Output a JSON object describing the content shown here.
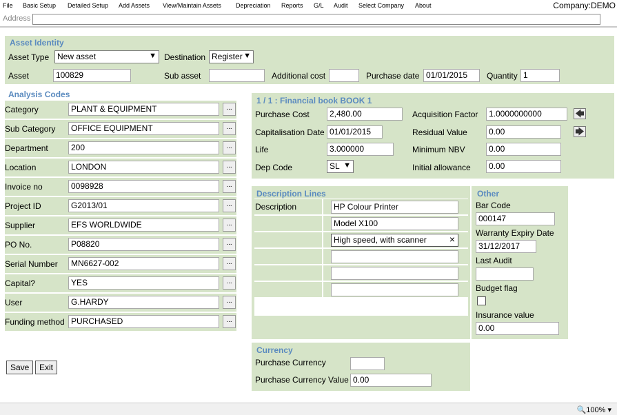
{
  "menu": {
    "items": [
      "File",
      "Basic Setup",
      "Detailed Setup",
      "Add Assets",
      "View/Maintain Assets",
      "Depreciation",
      "Reports",
      "G/L",
      "Audit",
      "Select Company",
      "About"
    ],
    "company": "Company:DEMO"
  },
  "address": {
    "label": "Address",
    "value": ""
  },
  "identity": {
    "title": "Asset Identity",
    "asset_type_label": "Asset Type",
    "asset_type_value": "New asset",
    "destination_label": "Destination",
    "destination_value": "Register",
    "asset_label": "Asset",
    "asset_value": "100829",
    "sub_asset_label": "Sub asset",
    "sub_asset_value": "",
    "additional_cost_label": "Additional cost",
    "additional_cost_value": "",
    "purchase_date_label": "Purchase date",
    "purchase_date_value": "01/01/2015",
    "quantity_label": "Quantity",
    "quantity_value": "1"
  },
  "analysis": {
    "title": "Analysis Codes",
    "rows": [
      {
        "label": "Category",
        "value": "PLANT & EQUIPMENT"
      },
      {
        "label": "Sub Category",
        "value": "OFFICE EQUIPMENT"
      },
      {
        "label": "Department",
        "value": "200"
      },
      {
        "label": "Location",
        "value": "LONDON"
      },
      {
        "label": "Invoice no",
        "value": "0098928"
      },
      {
        "label": "Project ID",
        "value": "G2013/01"
      },
      {
        "label": "Supplier",
        "value": "EFS WORLDWIDE"
      },
      {
        "label": "PO No.",
        "value": "P08820"
      },
      {
        "label": "Serial Number",
        "value": "MN6627-002"
      },
      {
        "label": "Capital?",
        "value": "YES"
      },
      {
        "label": "User",
        "value": "G.HARDY"
      },
      {
        "label": "Funding method",
        "value": "PURCHASED"
      }
    ],
    "lookup_label": "..."
  },
  "financial": {
    "title": "1 / 1 : Financial book BOOK 1",
    "purchase_cost_label": "Purchase Cost",
    "purchase_cost_value": "2,480.00",
    "acq_factor_label": "Acquisition Factor",
    "acq_factor_value": "1.0000000000",
    "cap_date_label": "Capitalisation Date",
    "cap_date_value": "01/01/2015",
    "residual_label": "Residual Value",
    "residual_value": "0.00",
    "life_label": "Life",
    "life_value": "3.000000",
    "min_nbv_label": "Minimum NBV",
    "min_nbv_value": "0.00",
    "dep_code_label": "Dep Code",
    "dep_code_value": "SL",
    "initial_allowance_label": "Initial allowance",
    "initial_allowance_value": "0.00"
  },
  "description": {
    "title": "Description Lines",
    "label": "Description",
    "lines": [
      "HP Colour Printer",
      "Model X100",
      "High speed, with scanner",
      "",
      "",
      ""
    ],
    "clear_glyph": "×"
  },
  "other": {
    "title": "Other",
    "bar_code_label": "Bar Code",
    "bar_code_value": "000147",
    "warranty_label": "Warranty Expiry Date",
    "warranty_value": "31/12/2017",
    "last_audit_label": "Last Audit",
    "last_audit_value": "",
    "budget_flag_label": "Budget flag",
    "insurance_label": "Insurance value",
    "insurance_value": "0.00"
  },
  "currency": {
    "title": "Currency",
    "purchase_currency_label": "Purchase Currency",
    "purchase_currency_value": "",
    "purchase_currency_value_label": "Purchase Currency Value",
    "purchase_currency_value_value": "0.00"
  },
  "buttons": {
    "save": "Save",
    "exit": "Exit"
  },
  "status": {
    "zoom": "100%"
  },
  "colors": {
    "panel": "#d6e4c8",
    "title": "#5b8bbf"
  }
}
